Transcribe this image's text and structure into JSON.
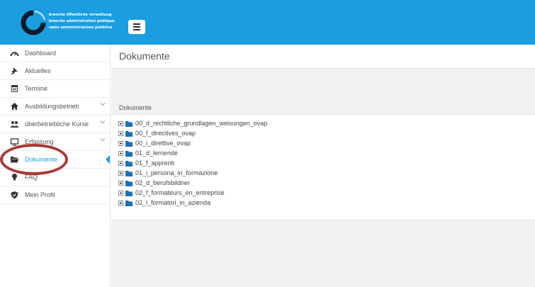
{
  "header": {
    "logo_lines": [
      "branche öffentliche verwaltung",
      "branche administration publique",
      "ramo amministrazione pubblica"
    ],
    "menu_toggle_icon": "hamburger-icon"
  },
  "sidebar": {
    "items": [
      {
        "label": "Dashboard",
        "icon": "gauge-icon",
        "has_chevron": false
      },
      {
        "label": "Aktuelles",
        "icon": "pin-icon",
        "has_chevron": false
      },
      {
        "label": "Termine",
        "icon": "calendar-icon",
        "has_chevron": false
      },
      {
        "label": "Ausbildungsbetrieb",
        "icon": "home-icon",
        "has_chevron": true
      },
      {
        "label": "überbetriebliche Kurse",
        "icon": "users-icon",
        "has_chevron": true
      },
      {
        "label": "Erfassung",
        "icon": "monitor-icon",
        "has_chevron": true
      },
      {
        "label": "Dokumente",
        "icon": "folder-open-icon",
        "has_chevron": false,
        "active": true
      },
      {
        "label": "FAQ",
        "icon": "lightbulb-icon",
        "has_chevron": false
      },
      {
        "label": "Mein Profil",
        "icon": "shield-icon",
        "has_chevron": false
      }
    ],
    "accent_color": "#1a9ee0"
  },
  "main": {
    "page_title": "Dokumente",
    "section_title": "Dokumente",
    "folders": [
      "00_d_rechtliche_grundlagen_weisungen_ovap",
      "00_f_directives_ovap",
      "00_i_direttive_ovap",
      "01_d_lernende",
      "01_f_apprenti",
      "01_i_persona_in_formazione",
      "02_d_berufsbildner",
      "02_f_formateurs_en_entreprise",
      "02_i_formatori_in_azienda"
    ]
  },
  "colors": {
    "header_bg": "#1a9ee0",
    "annotation": "#a53a3a",
    "folder": "#1a6fb5"
  }
}
